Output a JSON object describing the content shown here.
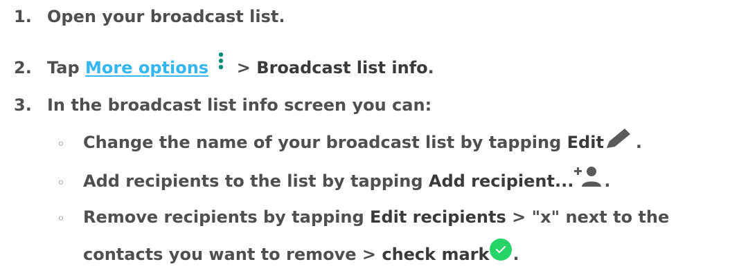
{
  "steps": [
    {
      "number": "1.",
      "text": "Open your broadcast list."
    },
    {
      "number": "2.",
      "prefix": "Tap ",
      "link": "More options",
      "separator": " > ",
      "target": "Broadcast list info",
      "end": "."
    },
    {
      "number": "3.",
      "text": "In the broadcast list info screen you can:"
    }
  ],
  "bullets": [
    {
      "text": "Change the name of your broadcast list by tapping ",
      "bold": "Edit",
      "icon": "pencil-icon",
      "end": "."
    },
    {
      "text": "Add recipients to the list by tapping ",
      "bold": "Add recipient...",
      "icon": "add-person-icon",
      "end": "."
    },
    {
      "text": "Remove recipients by tapping ",
      "bold": "Edit recipients",
      "middle": " > \"x\" next to the",
      "cont_text": "contacts you want to remove > ",
      "cont_bold": "check mark",
      "icon": "check-circle-icon",
      "end": "."
    }
  ],
  "bullet_glyph": "◦",
  "colors": {
    "text": "#4f4f4f",
    "link": "#34b7f1",
    "more_options_dots": "#0b8a76",
    "check_green": "#25d366"
  }
}
